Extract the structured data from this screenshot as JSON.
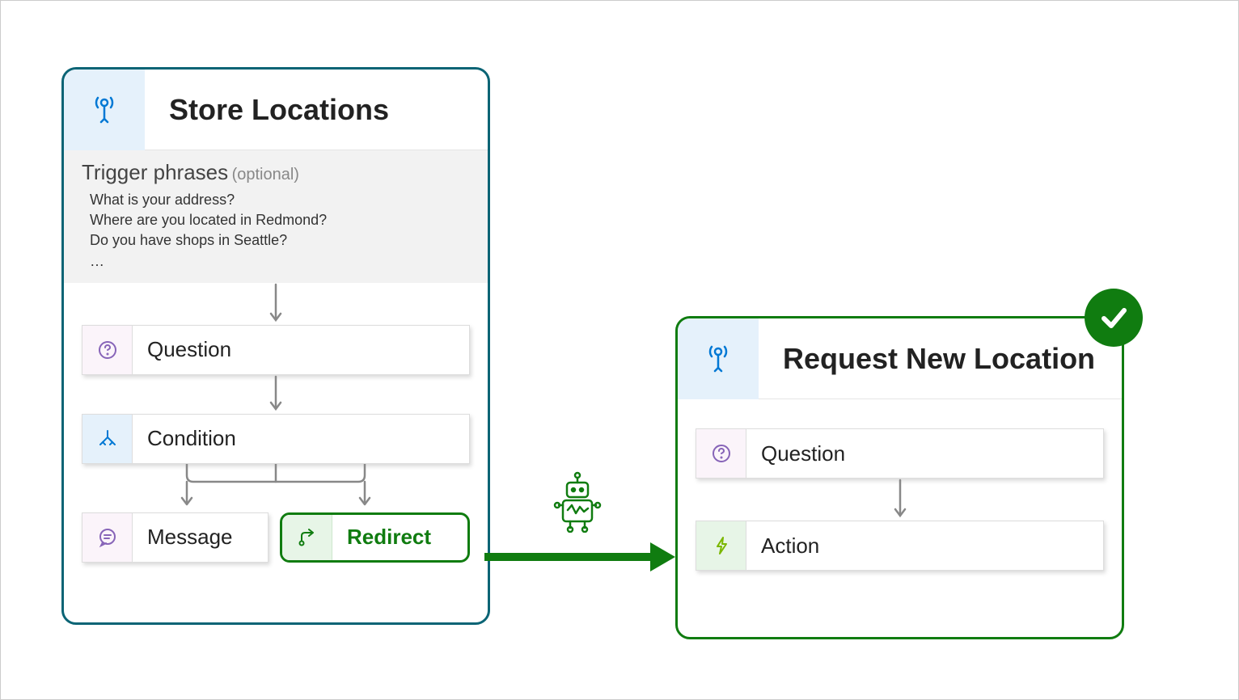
{
  "left": {
    "title": "Store Locations",
    "trigger_label": "Trigger phrases",
    "trigger_optional": "(optional)",
    "phrases": [
      "What is your address?",
      "Where are you located in Redmond?",
      "Do you have shops in Seattle?",
      "…"
    ],
    "nodes": {
      "question": "Question",
      "condition": "Condition",
      "message": "Message",
      "redirect": "Redirect"
    }
  },
  "right": {
    "title": "Request New Location",
    "nodes": {
      "question": "Question",
      "action": "Action"
    }
  }
}
